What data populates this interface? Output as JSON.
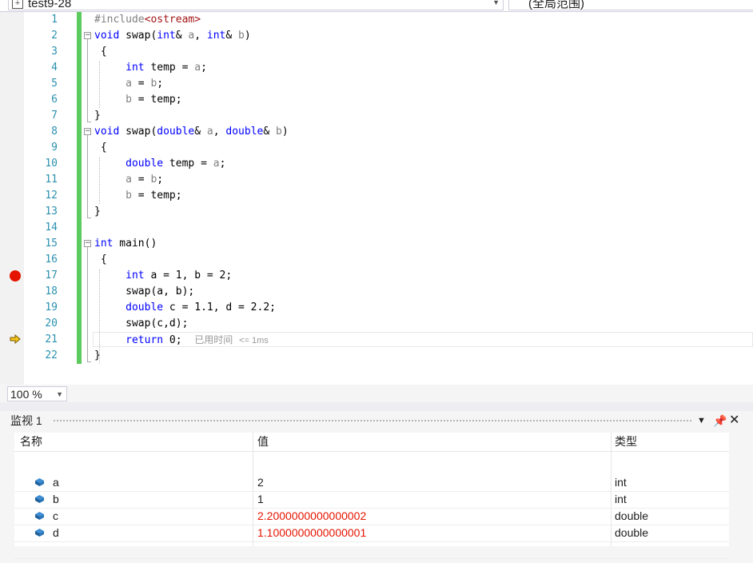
{
  "navbar": {
    "project": "test9-28",
    "scope": "(全局范围)"
  },
  "editor": {
    "line_numbers": [
      "1",
      "2",
      "3",
      "4",
      "5",
      "6",
      "7",
      "8",
      "9",
      "10",
      "11",
      "12",
      "13",
      "14",
      "15",
      "16",
      "17",
      "18",
      "19",
      "20",
      "21",
      "22"
    ],
    "perf_tip": "已用时间",
    "perf_tip_value": "<= 1ms",
    "breakpoint_line": "17",
    "current_line": "21"
  },
  "zoom": {
    "value": "100 %"
  },
  "watch": {
    "title": "监视 1",
    "columns": {
      "name": "名称",
      "value": "值",
      "type": "类型"
    },
    "rows": [
      {
        "name": "a",
        "value": "2",
        "type": "int",
        "changed": false
      },
      {
        "name": "b",
        "value": "1",
        "type": "int",
        "changed": false
      },
      {
        "name": "c",
        "value": "2.2000000000000002",
        "type": "double",
        "changed": true
      },
      {
        "name": "d",
        "value": "1.1000000000000001",
        "type": "double",
        "changed": true
      }
    ]
  },
  "colors": {
    "keyword": "#0000ff",
    "line_number": "#2b91af",
    "changed_value": "#e51400",
    "change_bar": "#5ccb5f"
  }
}
